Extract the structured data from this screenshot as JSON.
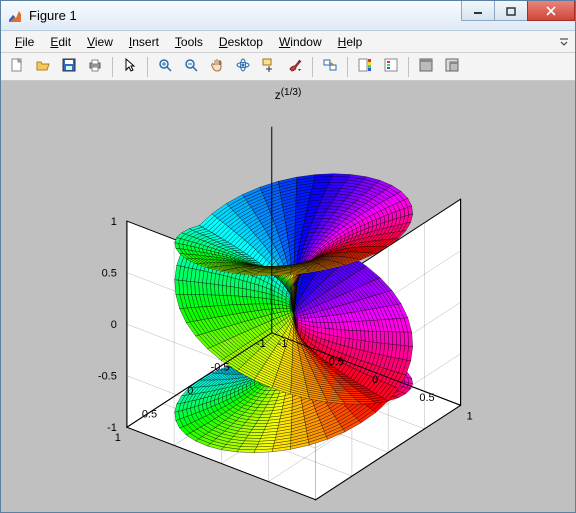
{
  "window": {
    "title": "Figure 1"
  },
  "menu": {
    "items": [
      "File",
      "Edit",
      "View",
      "Insert",
      "Tools",
      "Desktop",
      "Window",
      "Help"
    ],
    "accel": [
      0,
      0,
      0,
      0,
      0,
      0,
      0,
      0
    ]
  },
  "toolbar": {
    "icons": [
      "new-file",
      "open-file",
      "save",
      "print",
      "|",
      "pointer",
      "|",
      "zoom-in",
      "zoom-out",
      "pan",
      "rotate-3d",
      "data-cursor",
      "brush",
      "|",
      "link-plot",
      "|",
      "colorbar",
      "legend",
      "|",
      "hide-tools",
      "dock"
    ]
  },
  "chart_data": {
    "type": "surface-3d",
    "title": "z^(1/3)",
    "description": "Riemann surface of the complex cube root function z^(1/3), three-sheeted surface displayed over the complex plane.",
    "x_range": [
      -1,
      1
    ],
    "y_range": [
      -1,
      1
    ],
    "z_range": [
      -1,
      1
    ],
    "x_ticks": [
      -1,
      -0.5,
      0,
      0.5,
      1
    ],
    "y_ticks": [
      -1,
      -0.5,
      0,
      0.5,
      1
    ],
    "z_ticks": [
      -1,
      -0.5,
      0,
      0.5,
      1
    ],
    "r_samples": 30,
    "theta_samples": 120,
    "theta_turns": 3,
    "colormap": "hsv",
    "edge_color": "#000000",
    "view": {
      "azimuth": -37.5,
      "elevation": 30
    }
  },
  "colors": {
    "figure_bg": "#c0c0c0",
    "axes_bg": "#ffffff",
    "grid": "#000000",
    "close_btn": "#d1453a"
  }
}
